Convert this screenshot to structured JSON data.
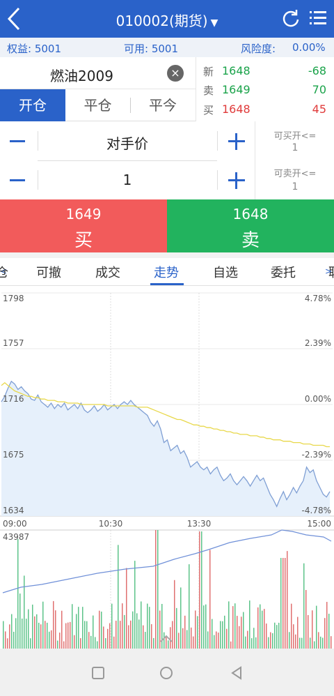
{
  "header": {
    "title": "010002(期货)",
    "caret": "▼",
    "back_icon": "chevron-left-icon",
    "refresh_icon": "refresh-icon",
    "menu_icon": "list-menu-icon",
    "bg": "#2a62c9"
  },
  "account": {
    "equity_label": "权益: 5001",
    "available_label": "可用: 5001",
    "risk_label": "风险度:",
    "risk_value": "0.00%"
  },
  "contract": {
    "name": "燃油2009",
    "clear_icon": "×"
  },
  "order_tabs": [
    {
      "label": "开仓",
      "active": true
    },
    {
      "label": "平仓"
    },
    {
      "label": "平今"
    }
  ],
  "quote": {
    "rows": [
      {
        "label": "新",
        "price": "1648",
        "volume": "-68",
        "price_color": "#1aa34a",
        "volume_color": "#1aa34a"
      },
      {
        "label": "卖",
        "price": "1649",
        "volume": "70",
        "price_color": "#1aa34a",
        "volume_color": "#1aa34a"
      },
      {
        "label": "买",
        "price": "1648",
        "volume": "45",
        "price_color": "#e03b3b",
        "volume_color": "#e03b3b"
      }
    ]
  },
  "order": {
    "price_mode": "对手价",
    "quantity": "1"
  },
  "avail": {
    "buy_label": "可买开<=",
    "buy_value": "1",
    "sell_label": "可卖开<=",
    "sell_value": "1"
  },
  "trade": {
    "buy_price": "1649",
    "buy_label": "买",
    "sell_price": "1648",
    "sell_label": "卖",
    "buy_color": "#f25b5b",
    "sell_color": "#22b35e"
  },
  "nav": {
    "left_arrow": "<",
    "right_arrow": ">",
    "items": [
      "仓",
      "可撤",
      "成交",
      "走势",
      "自选",
      "委托",
      "职"
    ],
    "active": "走势"
  },
  "chart_data": {
    "type": "line",
    "price_ticks": [
      "1798",
      "1757",
      "1716",
      "1675",
      "1634"
    ],
    "pct_ticks": [
      "4.78%",
      "2.39%",
      "0.00%",
      "-2.39%",
      "-4.78%"
    ],
    "time_ticks": [
      "09:00",
      "10:30",
      "13:30",
      "15:00"
    ],
    "ylim": [
      1634,
      1798
    ],
    "volume_max_label": "43987",
    "series": [
      {
        "values": [
          1718,
          1722,
          1728,
          1733,
          1731,
          1727,
          1729,
          1726,
          1724,
          1720,
          1719,
          1723,
          1718,
          1716,
          1714,
          1717,
          1713,
          1716,
          1714,
          1717,
          1712,
          1714,
          1716,
          1713,
          1717,
          1712,
          1710,
          1712,
          1715,
          1711,
          1713,
          1716,
          1712,
          1714,
          1716,
          1713,
          1716,
          1718,
          1716,
          1719,
          1716,
          1714,
          1712,
          1710,
          1708,
          1703,
          1700,
          1704,
          1698,
          1688,
          1690,
          1682,
          1684,
          1686,
          1680,
          1682,
          1677,
          1670,
          1672,
          1674,
          1670,
          1668,
          1670,
          1665,
          1668,
          1670,
          1664,
          1660,
          1662,
          1665,
          1660,
          1657,
          1660,
          1663,
          1660,
          1656,
          1660,
          1664,
          1660,
          1662,
          1656,
          1650,
          1646,
          1641,
          1647,
          1652,
          1646,
          1650,
          1655,
          1651,
          1656,
          1660,
          1670,
          1666,
          1668,
          1660,
          1655,
          1650,
          1648,
          1652
        ],
        "color": "#7f9fd4"
      },
      {
        "values": [
          1730,
          1732,
          1730,
          1728,
          1726,
          1725,
          1724,
          1723,
          1722,
          1722,
          1721,
          1721,
          1720,
          1720,
          1719,
          1719,
          1719,
          1718,
          1718,
          1718,
          1717,
          1717,
          1717,
          1717,
          1716,
          1716,
          1716,
          1716,
          1716,
          1716,
          1716,
          1716,
          1715,
          1715,
          1715,
          1715,
          1715,
          1715,
          1715,
          1715,
          1715,
          1714,
          1714,
          1714,
          1714,
          1713,
          1712,
          1711,
          1710,
          1709,
          1708,
          1707,
          1706,
          1705,
          1705,
          1704,
          1703,
          1702,
          1701,
          1701,
          1700,
          1700,
          1699,
          1699,
          1698,
          1698,
          1697,
          1697,
          1696,
          1696,
          1695,
          1695,
          1694,
          1694,
          1694,
          1693,
          1693,
          1693,
          1692,
          1692,
          1691,
          1691,
          1690,
          1690,
          1690,
          1689,
          1689,
          1689,
          1688,
          1688,
          1688,
          1687,
          1687,
          1687,
          1686,
          1686,
          1686,
          1686,
          1685,
          1685
        ],
        "color": "#e8d84a"
      }
    ]
  },
  "system_nav": {
    "recent": "square-icon",
    "home": "circle-icon",
    "back": "triangle-back-icon"
  }
}
